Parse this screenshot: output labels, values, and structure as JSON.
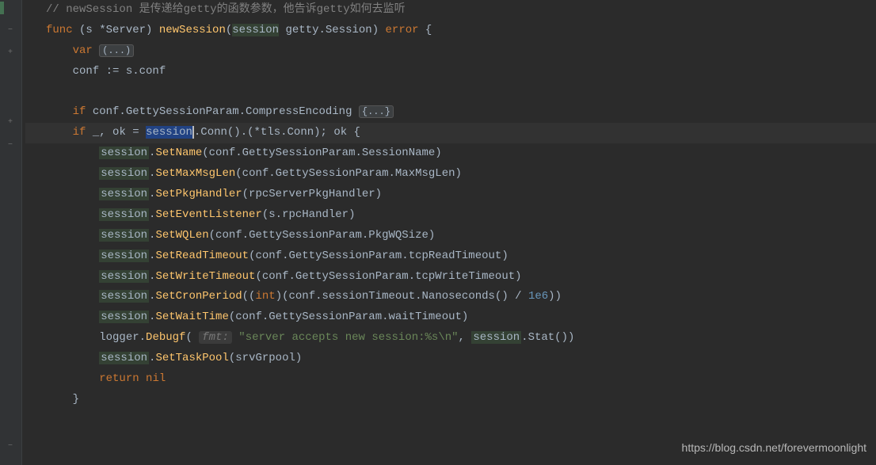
{
  "code": {
    "line1_comment": "// newSession 是传递给getty的函数参数，他告诉getty如何去监听",
    "line2": {
      "kw_func": "func",
      "receiver": "(s *Server)",
      "name": "newSession",
      "param_name": "session",
      "param_type": "getty.Session",
      "ret": "error"
    },
    "line3": {
      "kw_var": "var",
      "fold": "(...)"
    },
    "line4": "    conf := s.conf",
    "line6": {
      "kw_if": "if",
      "expr": "conf.GettySessionParam.CompressEncoding",
      "fold": "{...}"
    },
    "line7": {
      "kw_if": "if",
      "blank": "_",
      "ok_var": "ok",
      "eq": "=",
      "session": "session",
      "rest1": ".Conn().(*tls.Conn); ok {"
    },
    "line8": {
      "session": "session",
      "method": "SetName",
      "args": "(conf.GettySessionParam.SessionName)"
    },
    "line9": {
      "session": "session",
      "method": "SetMaxMsgLen",
      "args": "(conf.GettySessionParam.MaxMsgLen)"
    },
    "line10": {
      "session": "session",
      "method": "SetPkgHandler",
      "args": "(rpcServerPkgHandler)"
    },
    "line11": {
      "session": "session",
      "method": "SetEventListener",
      "args": "(s.rpcHandler)"
    },
    "line12": {
      "session": "session",
      "method": "SetWQLen",
      "args": "(conf.GettySessionParam.PkgWQSize)"
    },
    "line13": {
      "session": "session",
      "method": "SetReadTimeout",
      "args": "(conf.GettySessionParam.tcpReadTimeout)"
    },
    "line14": {
      "session": "session",
      "method": "SetWriteTimeout",
      "args": "(conf.GettySessionParam.tcpWriteTimeout)"
    },
    "line15": {
      "session": "session",
      "method": "SetCronPeriod",
      "prefix": "((",
      "cast": "int",
      "mid": ")(conf.sessionTimeout.Nanoseconds() / ",
      "num": "1e6",
      "suffix": "))"
    },
    "line16": {
      "session": "session",
      "method": "SetWaitTime",
      "args": "(conf.GettySessionParam.waitTimeout)"
    },
    "line17": {
      "logger": "logger",
      "method": "Debugf",
      "hint": "fmt:",
      "str": "\"server accepts new session:%s\\n\"",
      "comma": ", ",
      "session": "session",
      "stat": ".Stat())"
    },
    "line18": {
      "session": "session",
      "method": "SetTaskPool",
      "args": "(srvGrpool)"
    },
    "line19": {
      "kw_return": "return",
      "nil": "nil"
    },
    "line20": "    }"
  },
  "gutter": {
    "fold_minus": "−",
    "fold_plus": "+",
    "bulb": "💡"
  },
  "watermark": "https://blog.csdn.net/forevermoonlight"
}
